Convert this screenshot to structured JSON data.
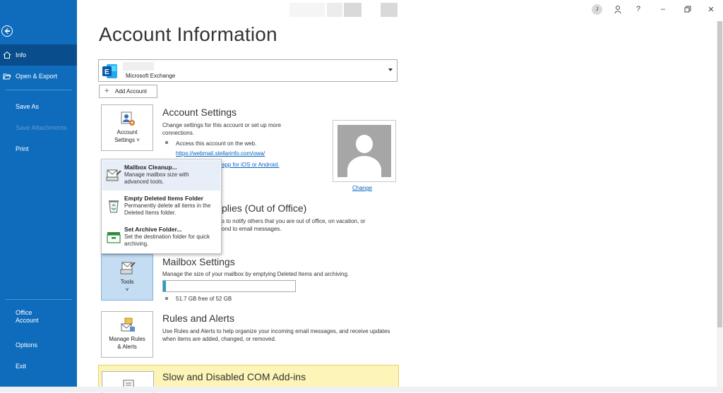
{
  "sidebar": {
    "items": [
      {
        "label": "Info"
      },
      {
        "label": "Open & Export"
      },
      {
        "label": "Save As"
      },
      {
        "label": "Save Attachments"
      },
      {
        "label": "Print"
      },
      {
        "label": "Office\nAccount"
      },
      {
        "label": "Options"
      },
      {
        "label": "Exit"
      }
    ]
  },
  "titlebar": {
    "avatar_initial": "J",
    "help": "?",
    "minimize": "–",
    "close": "✕"
  },
  "page": {
    "title": "Account Information"
  },
  "account": {
    "type": "Microsoft Exchange",
    "add_account": "Add Account"
  },
  "account_settings": {
    "button": "Account\nSettings ˅",
    "heading": "Account Settings",
    "desc": "Change settings for this account or set up more connections.",
    "web_access": "Access this account on the web.",
    "owa_link": "https://webmail.stellarinfo.com/owa/",
    "mobile_link": "app for iOS or Android.",
    "change_photo": "Change"
  },
  "menu": {
    "items": [
      {
        "title": "Mailbox Cleanup...",
        "desc": "Manage mailbox size with advanced tools."
      },
      {
        "title": "Empty Deleted Items Folder",
        "desc": "Permanently delete all items in the Deleted Items folder."
      },
      {
        "title": "Set Archive Folder...",
        "desc": "Set the destination folder for quick archiving."
      }
    ]
  },
  "auto_replies": {
    "heading_tail": "plies (Out of Office)",
    "line1_tail": "s to notify others that you are out of office, on vacation, or",
    "line2_tail": "ond to email messages."
  },
  "mailbox": {
    "button": "Tools\n˅",
    "heading": "Mailbox Settings",
    "desc": "Manage the size of your mailbox by emptying Deleted Items and archiving.",
    "free_text": "51.7 GB free of 52 GB",
    "used_fraction": 0.006
  },
  "rules": {
    "button": "Manage Rules\n& Alerts",
    "heading": "Rules and Alerts",
    "desc": "Use Rules and Alerts to help organize your incoming email messages, and receive updates when items are added, changed, or removed."
  },
  "com": {
    "heading": "Slow and Disabled COM Add-ins"
  },
  "colors": {
    "sidebar": "#0f6cbd",
    "accent_link": "#0563c1",
    "quota_fill": "#2e9bc6",
    "com_panel": "#fdf4b8"
  }
}
